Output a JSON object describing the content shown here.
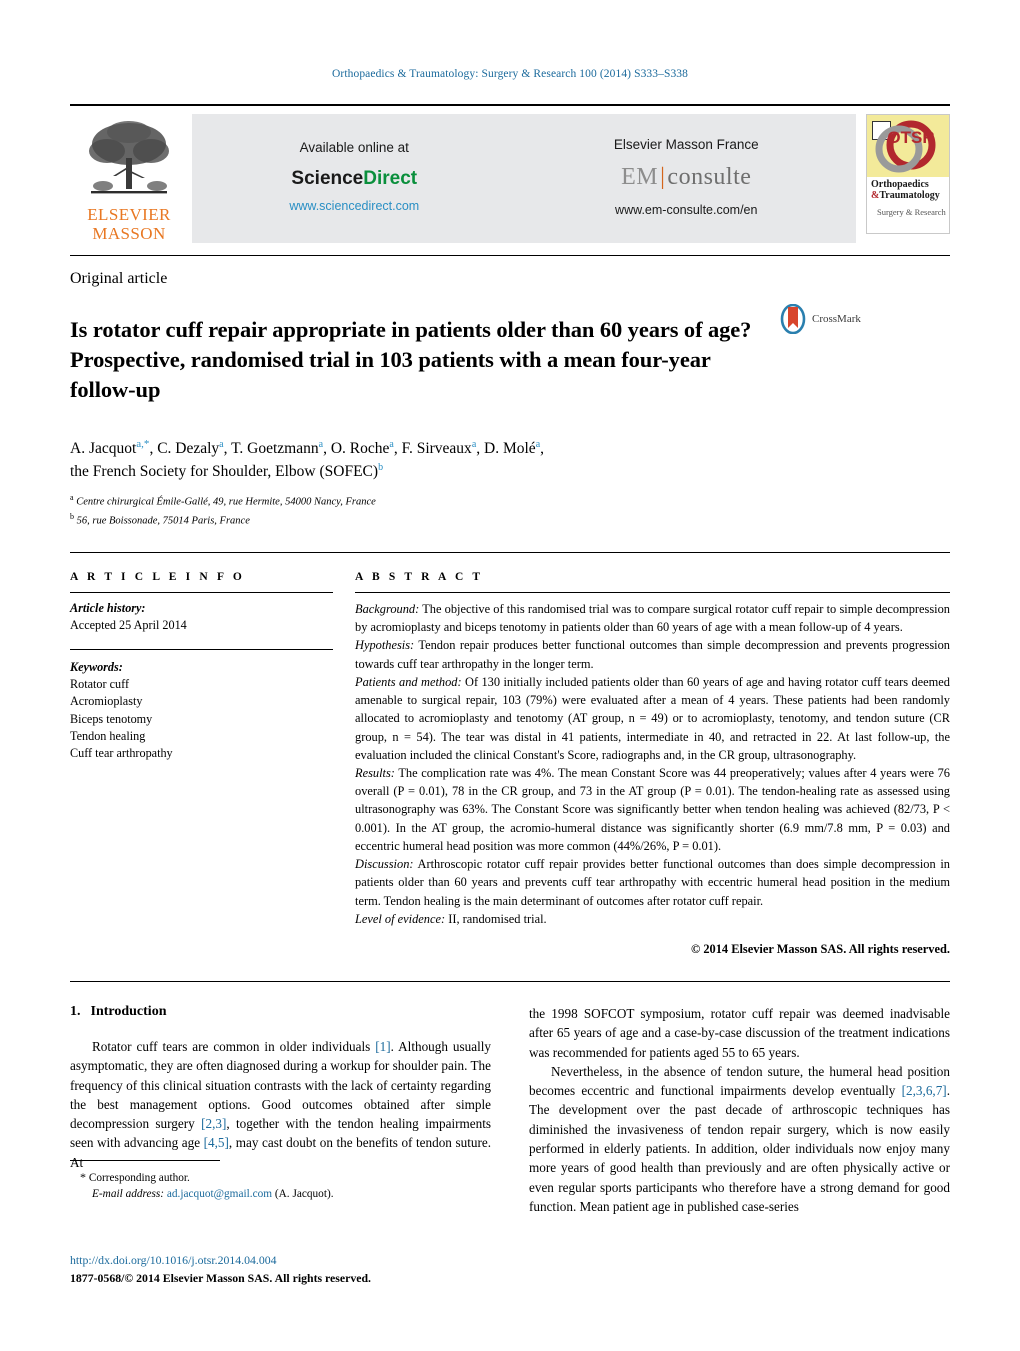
{
  "running_head": "Orthopaedics & Traumatology: Surgery & Research 100 (2014) S333–S338",
  "masthead": {
    "publisher_logo_line1": "ELSEVIER",
    "publisher_logo_line2": "MASSON",
    "sciencedirect": {
      "available_text": "Available online at",
      "brand_part1": "Science",
      "brand_part2": "Direct",
      "url": "www.sciencedirect.com"
    },
    "emconsulte": {
      "publisher_text": "Elsevier Masson France",
      "brand_part1": "EM",
      "brand_part2": "consulte",
      "url": "www.em-consulte.com/en"
    },
    "journal_cover": {
      "badge": "OTSR",
      "title_line1": "Orthopaedics",
      "title_amp": "&",
      "title_line2": "Traumatology",
      "subtitle": "Surgery & Research"
    }
  },
  "article": {
    "kicker": "Original article",
    "title": "Is rotator cuff repair appropriate in patients older than 60 years of age? Prospective, randomised trial in 103 patients with a mean four-year follow-up",
    "crossmark_label": "CrossMark",
    "authors_line1_parts": [
      {
        "name": "A. Jacquot",
        "sup": "a,*"
      },
      {
        "name": "C. Dezaly",
        "sup": "a"
      },
      {
        "name": "T. Goetzmann",
        "sup": "a"
      },
      {
        "name": "O. Roche",
        "sup": "a"
      },
      {
        "name": "F. Sirveaux",
        "sup": "a"
      },
      {
        "name": "D. Molé",
        "sup": "a"
      }
    ],
    "authors_line2": "the French Society for Shoulder, Elbow (SOFEC)",
    "authors_line2_sup": "b",
    "affiliations": [
      {
        "marker": "a",
        "text": "Centre chirurgical Émile-Gallé, 49, rue Hermite, 54000 Nancy, France"
      },
      {
        "marker": "b",
        "text": "56, rue Boissonade, 75014 Paris, France"
      }
    ]
  },
  "article_info": {
    "heading": "A R T I C L E   I N F O",
    "history_label": "Article history:",
    "history_value": "Accepted 25 April 2014",
    "keywords_label": "Keywords:",
    "keywords": [
      "Rotator cuff",
      "Acromioplasty",
      "Biceps tenotomy",
      "Tendon healing",
      "Cuff tear arthropathy"
    ]
  },
  "abstract": {
    "heading": "A B S T R A C T",
    "sections": [
      {
        "label": "Background:",
        "text": " The objective of this randomised trial was to compare surgical rotator cuff repair to simple decompression by acromioplasty and biceps tenotomy in patients older than 60 years of age with a mean follow-up of 4 years."
      },
      {
        "label": "Hypothesis:",
        "text": " Tendon repair produces better functional outcomes than simple decompression and prevents progression towards cuff tear arthropathy in the longer term."
      },
      {
        "label": "Patients and method:",
        "text": " Of 130 initially included patients older than 60 years of age and having rotator cuff tears deemed amenable to surgical repair, 103 (79%) were evaluated after a mean of 4 years. These patients had been randomly allocated to acromioplasty and tenotomy (AT group, n = 49) or to acromioplasty, tenotomy, and tendon suture (CR group, n = 54). The tear was distal in 41 patients, intermediate in 40, and retracted in 22. At last follow-up, the evaluation included the clinical Constant's Score, radiographs and, in the CR group, ultrasonography."
      },
      {
        "label": "Results:",
        "text": " The complication rate was 4%. The mean Constant Score was 44 preoperatively; values after 4 years were 76 overall (P = 0.01), 78 in the CR group, and 73 in the AT group (P = 0.01). The tendon-healing rate as assessed using ultrasonography was 63%. The Constant Score was significantly better when tendon healing was achieved (82/73, P < 0.001). In the AT group, the acromio-humeral distance was significantly shorter (6.9 mm/7.8 mm, P = 0.03) and eccentric humeral head position was more common (44%/26%, P = 0.01)."
      },
      {
        "label": "Discussion:",
        "text": " Arthroscopic rotator cuff repair provides better functional outcomes than does simple decompression in patients older than 60 years and prevents cuff tear arthropathy with eccentric humeral head position in the medium term. Tendon healing is the main determinant of outcomes after rotator cuff repair."
      },
      {
        "label": "Level of evidence:",
        "text": " II, randomised trial."
      }
    ],
    "copyright": "© 2014 Elsevier Masson SAS. All rights reserved."
  },
  "body": {
    "section_number": "1.",
    "section_title": "Introduction",
    "left_paragraphs": [
      {
        "runs": [
          {
            "t": "Rotator cuff tears are common in older individuals "
          },
          {
            "t": "[1]",
            "ref": true
          },
          {
            "t": ". Although usually asymptomatic, they are often diagnosed during a workup for shoulder pain. The frequency of this clinical situation contrasts with the lack of certainty regarding the best management options. Good outcomes obtained after simple decompression surgery "
          },
          {
            "t": "[2,3]",
            "ref": true
          },
          {
            "t": ", together with the tendon healing impairments seen with advancing age "
          },
          {
            "t": "[4,5]",
            "ref": true
          },
          {
            "t": ", may cast doubt on the benefits of tendon suture. At"
          }
        ]
      }
    ],
    "right_paragraphs": [
      {
        "indent": false,
        "runs": [
          {
            "t": "the 1998 SOFCOT symposium, rotator cuff repair was deemed inadvisable after 65 years of age and a case-by-case discussion of the treatment indications was recommended for patients aged 55 to 65 years."
          }
        ]
      },
      {
        "indent": true,
        "runs": [
          {
            "t": "Nevertheless, in the absence of tendon suture, the humeral head position becomes eccentric and functional impairments develop eventually "
          },
          {
            "t": "[2,3,6,7]",
            "ref": true
          },
          {
            "t": ". The development over the past decade of arthroscopic techniques has diminished the invasiveness of tendon repair surgery, which is now easily performed in elderly patients. In addition, older individuals now enjoy many more years of good health than previously and are often physically active or even regular sports participants who therefore have a strong demand for good function. Mean patient age in published case-series"
          }
        ]
      }
    ]
  },
  "footnotes": {
    "corresponding_marker": "*",
    "corresponding_text": "Corresponding author.",
    "email_label": "E-mail address:",
    "email": "ad.jacquot@gmail.com",
    "email_owner": "(A. Jacquot)."
  },
  "publication_footer": {
    "doi": "http://dx.doi.org/10.1016/j.otsr.2014.04.004",
    "issn_line": "1877-0568/© 2014 Elsevier Masson SAS. All rights reserved."
  },
  "colors": {
    "link": "#1b6a9c",
    "sciencedirect_green": "#0a8f3c",
    "elsevier_orange": "#E87722",
    "banner_bg": "#e7e8ea"
  }
}
